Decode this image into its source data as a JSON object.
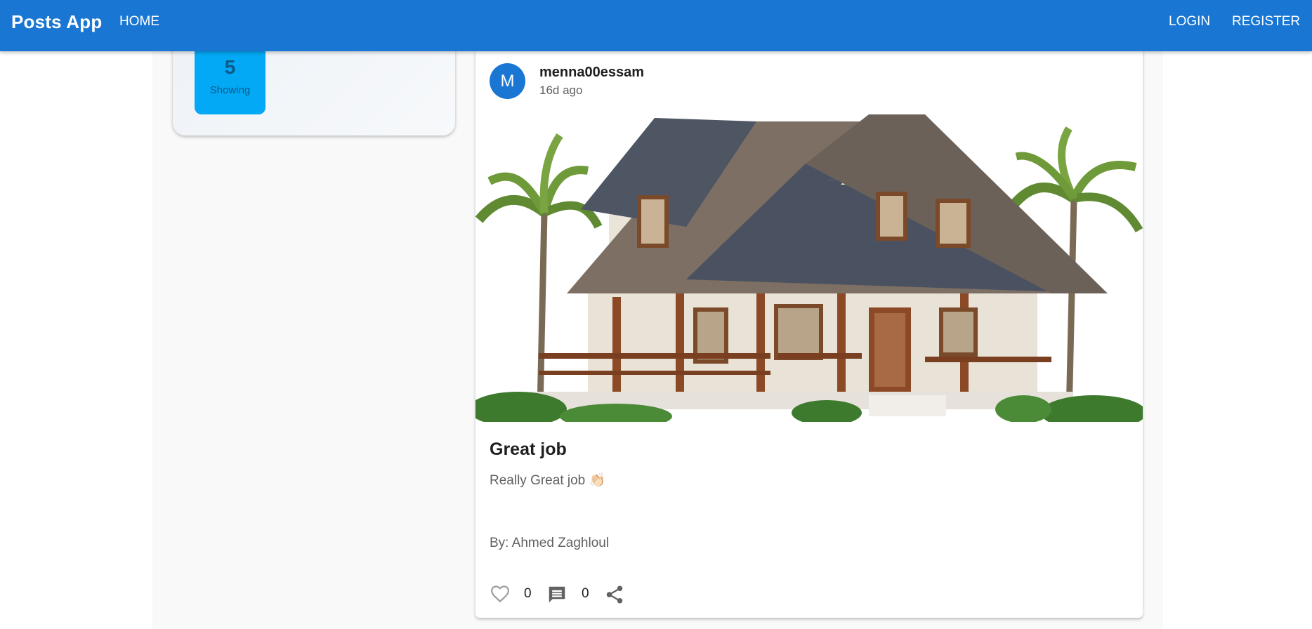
{
  "app": {
    "brand": "Posts App",
    "nav": {
      "home": "HOME",
      "login": "LOGIN",
      "register": "REGISTER"
    },
    "accent_color": "#1976d2"
  },
  "sidebar": {
    "stat": {
      "value": "5",
      "label": "Showing",
      "color": "#03a9f4"
    }
  },
  "post": {
    "avatar_letter": "M",
    "author": "menna00essam",
    "time_ago": "16d ago",
    "image_alt": "house with palm trees",
    "title": "Great job",
    "body": "Really Great job 👏🏻",
    "by": "By: Ahmed Zaghloul",
    "likes": "0",
    "comments": "0",
    "icons": {
      "like": "heart-outline-icon",
      "comment": "comment-icon",
      "share": "share-icon"
    }
  }
}
